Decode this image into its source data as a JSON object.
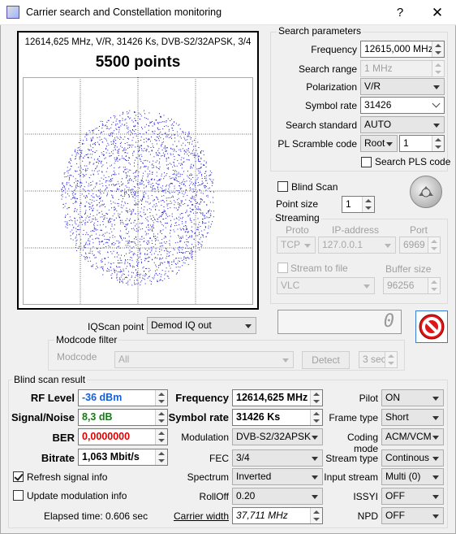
{
  "window": {
    "title": "Carrier search and Constellation monitoring",
    "help": "?",
    "close": "✕"
  },
  "constellation": {
    "info": "12614,625 MHz, V/R, 31426 Ks, DVB-S2/32APSK, 3/4",
    "points": "5500 points",
    "dot_color": "#1a1acc"
  },
  "search": {
    "group": "Search parameters",
    "frequency_label": "Frequency",
    "frequency": "12615,000 MHz",
    "range_label": "Search range",
    "range": "1 MHz",
    "polarization_label": "Polarization",
    "polarization": "V/R",
    "symbol_rate_label": "Symbol rate",
    "symbol_rate": "31426",
    "standard_label": "Search standard",
    "standard": "AUTO",
    "pl_label": "PL Scramble code",
    "pl_mode": "Root",
    "pl_value": "1",
    "pls_label": "Search PLS code"
  },
  "blind": {
    "label": "Blind Scan",
    "point_size_label": "Point size",
    "point_size": "1"
  },
  "streaming": {
    "group": "Streaming",
    "proto_label": "Proto",
    "proto": "TCP",
    "ip_label": "IP-address",
    "ip": "127.0.0.1",
    "port_label": "Port",
    "port": "6969",
    "stream_label": "Stream to file",
    "buffer_label": "Buffer size",
    "player": "VLC",
    "buffer": "96256"
  },
  "counter": "0",
  "iq": {
    "label": "IQScan point",
    "value": "Demod IQ out"
  },
  "modcode": {
    "group": "Modcode filter",
    "label": "Modcode",
    "value": "All",
    "detect": "Detect",
    "timeout": "3 sec"
  },
  "result": {
    "group": "Blind scan result",
    "rf_label": "RF Level",
    "rf": "-36 dBm",
    "rf_color": "#1560d8",
    "sn_label": "Signal/Noise",
    "sn": "8,3 dB",
    "sn_color": "#1a7a1a",
    "ber_label": "BER",
    "ber": "0,0000000",
    "ber_color": "#e00000",
    "bitrate_label": "Bitrate",
    "bitrate": "1,063 Mbit/s",
    "freq_label": "Frequency",
    "freq": "12614,625 MHz",
    "sr_label": "Symbol rate",
    "sr": "31426 Ks",
    "mod_label": "Modulation",
    "mod": "DVB-S2/32APSK",
    "fec_label": "FEC",
    "fec": "3/4",
    "spectrum_label": "Spectrum",
    "spectrum": "Inverted",
    "rolloff_label": "RollOff",
    "rolloff": "0.20",
    "cw_label": "Carrier width",
    "cw": "37,711 MHz",
    "pilot_label": "Pilot",
    "pilot": "ON",
    "frame_label": "Frame type",
    "frame": "Short",
    "coding_label": "Coding mode",
    "coding": "ACM/VCM",
    "stype_label": "Stream type",
    "stype": "Continous",
    "istream_label": "Input stream",
    "istream": "Multi (0)",
    "issyi_label": "ISSYI",
    "issyi": "OFF",
    "npd_label": "NPD",
    "npd": "OFF",
    "refresh_label": "Refresh signal info",
    "update_label": "Update modulation info",
    "elapsed": "Elapsed time: 0.606 sec"
  }
}
